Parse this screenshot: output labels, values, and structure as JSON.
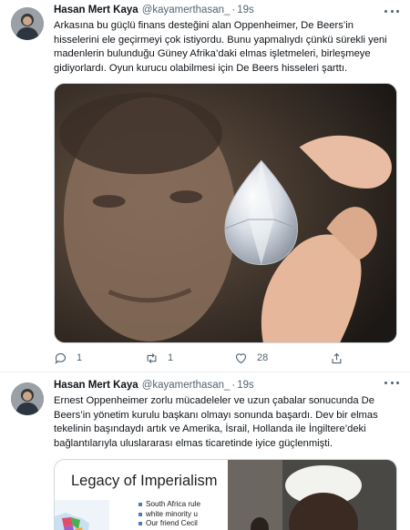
{
  "tweets": [
    {
      "author": {
        "name": "Hasan Mert Kaya",
        "handle": "@kayamerthasan_",
        "separator": "·",
        "time": "19s"
      },
      "text": "Arkasına bu güçlü finans desteğini alan Oppenheimer, De Beers’in hisselerini ele geçirmeyi çok istiyordu. Bunu yapmalıydı çünkü sürekli yeni madenlerin bulunduğu Güney Afrika’daki elmas işletmeleri, birleşmeye gidiyorlardı. Oyun kurucu olabilmesi için De Beers hisseleri şarttı.",
      "actions": {
        "reply_count": "1",
        "retweet_count": "1",
        "like_count": "28"
      }
    },
    {
      "author": {
        "name": "Hasan Mert Kaya",
        "handle": "@kayamerthasan_",
        "separator": "·",
        "time": "19s"
      },
      "text": "Ernest Oppenheimer zorlu mücadeleler ve uzun çabalar sonucunda De Beers’in yönetim kurulu başkanı olmayı sonunda başardı. Dev bir elmas tekelinin başındaydı artık ve Amerika, İsrail, Hollanda ile İngiltere’deki bağlantılarıyla uluslararası elmas ticaretinde iyice güçlenmişti.",
      "slide": {
        "title": "Legacy of Imperialism",
        "bullets": [
          "South Africa rule",
          "white minority u",
          "Our friend Cecil"
        ]
      }
    }
  ],
  "icons": {
    "more": "more-dots-icon",
    "reply": "reply-icon",
    "retweet": "retweet-icon",
    "like": "heart-icon",
    "share": "share-icon"
  },
  "colors": {
    "text": "#0f1419",
    "secondary": "#536471",
    "border": "#cfd9de"
  }
}
